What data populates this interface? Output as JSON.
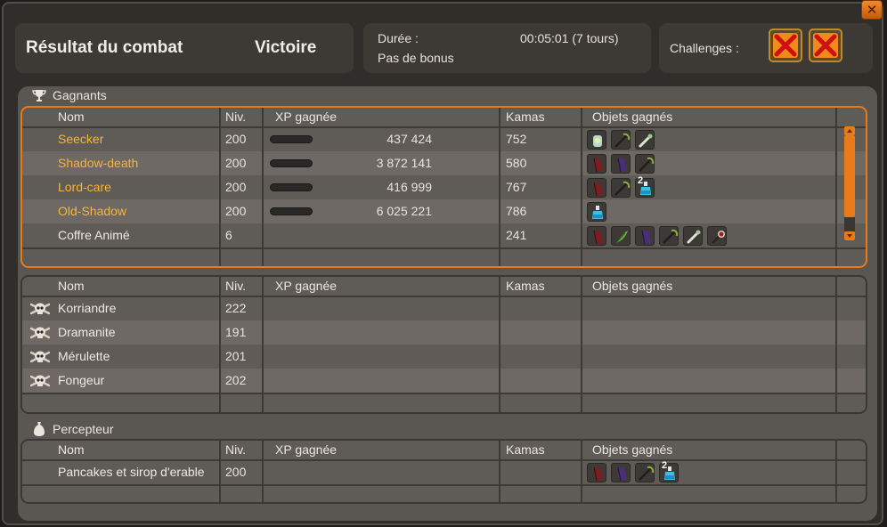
{
  "window": {
    "close_label": "✕"
  },
  "header": {
    "title": "Résultat du combat",
    "outcome": "Victoire",
    "duration_label": "Durée :",
    "duration_value": "00:05:01 (7 tours)",
    "bonus": "Pas de bonus",
    "challenges_label": "Challenges :"
  },
  "columns": {
    "name": "Nom",
    "level": "Niv.",
    "xp": "XP gagnée",
    "kamas": "Kamas",
    "items": "Objets gagnés"
  },
  "winners": {
    "label": "Gagnants",
    "rows": [
      {
        "name": "Seecker",
        "level": "200",
        "xp": "437 424",
        "kamas": "752",
        "xp_fill": 0.5,
        "items": [
          {
            "icon": "potion-gem-icon"
          },
          {
            "icon": "dark-scythe-icon"
          },
          {
            "icon": "bone-wand-icon"
          }
        ]
      },
      {
        "name": "Shadow-death",
        "level": "200",
        "xp": "3 872 141",
        "kamas": "580",
        "xp_fill": 0.5,
        "items": [
          {
            "icon": "red-cape-icon"
          },
          {
            "icon": "purple-cape-icon"
          },
          {
            "icon": "dark-scythe-icon"
          }
        ]
      },
      {
        "name": "Lord-care",
        "level": "200",
        "xp": "416 999",
        "kamas": "767",
        "xp_fill": 0.5,
        "items": [
          {
            "icon": "red-cape-icon"
          },
          {
            "icon": "dark-scythe-icon"
          },
          {
            "icon": "blue-potion-icon",
            "qty": "2"
          }
        ]
      },
      {
        "name": "Old-Shadow",
        "level": "200",
        "xp": "6 025 221",
        "kamas": "786",
        "xp_fill": 0.5,
        "items": [
          {
            "icon": "blue-potion-icon"
          }
        ]
      },
      {
        "name": "Coffre Animé",
        "level": "6",
        "xp": "",
        "kamas": "241",
        "items": [
          {
            "icon": "red-cape-icon"
          },
          {
            "icon": "green-feather-icon"
          },
          {
            "icon": "purple-cape-icon"
          },
          {
            "icon": "dark-scythe-icon"
          },
          {
            "icon": "bone-wand-icon"
          },
          {
            "icon": "red-staff-icon"
          }
        ]
      }
    ]
  },
  "losers": {
    "rows": [
      {
        "name": "Korriandre",
        "level": "222"
      },
      {
        "name": "Dramanite",
        "level": "191"
      },
      {
        "name": "Mérulette",
        "level": "201"
      },
      {
        "name": "Fongeur",
        "level": "202"
      }
    ]
  },
  "collector": {
    "label": "Percepteur",
    "rows": [
      {
        "name": "Pancakes et sirop d'erable",
        "level": "200",
        "items": [
          {
            "icon": "red-cape-icon"
          },
          {
            "icon": "purple-cape-icon"
          },
          {
            "icon": "dark-scythe-icon"
          },
          {
            "icon": "blue-potion-icon",
            "qty": "2"
          }
        ]
      }
    ]
  },
  "colors": {
    "accent": "#e87a1a",
    "winner_name": "#f5b53a",
    "panel": "#5a5651"
  }
}
